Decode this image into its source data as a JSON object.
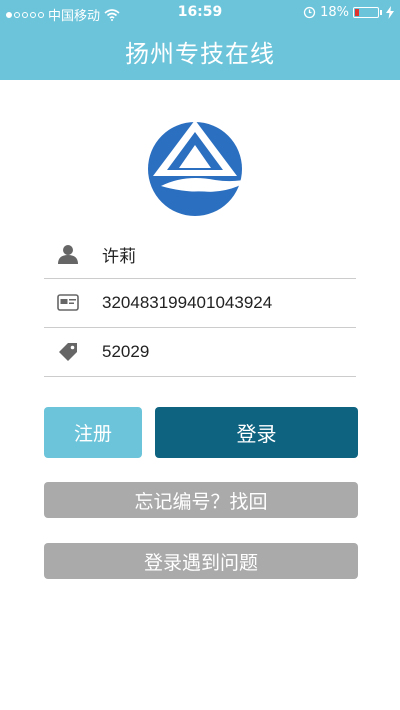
{
  "status_bar": {
    "carrier": "中国移动",
    "time": "16:59",
    "battery": "18%",
    "battery_level": 0.18
  },
  "header": {
    "title": "扬州专技在线"
  },
  "form": {
    "name_value": "许莉",
    "id_value": "320483199401043924",
    "code_value": "52029"
  },
  "buttons": {
    "register": "注册",
    "login": "登录",
    "forgot": "忘记编号？找回",
    "problem": "登录遇到问题"
  },
  "colors": {
    "header": "#6cc4da",
    "login_button": "#0e6380",
    "gray_button": "#aaaaaa",
    "logo_blue": "#2b6fc0"
  },
  "icons": [
    "user-icon",
    "id-card-icon",
    "tag-icon",
    "wifi-icon",
    "alarm-icon",
    "charging-icon"
  ]
}
